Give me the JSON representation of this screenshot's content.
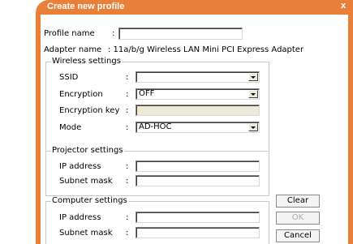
{
  "window": {
    "title": "Create new profile",
    "close_glyph": "x"
  },
  "profile": {
    "label": "Profile name",
    "colon": ":",
    "value": ""
  },
  "adapter": {
    "label": "Adapter name",
    "value": ": 11a/b/g Wireless LAN Mini PCI Express Adapter"
  },
  "wireless": {
    "title": "Wireless settings",
    "ssid": {
      "label": "SSID",
      "colon": ":",
      "value": ""
    },
    "encryption": {
      "label": "Encryption",
      "colon": ":",
      "value": "OFF"
    },
    "key": {
      "label": "Encryption key",
      "colon": ":",
      "value": ""
    },
    "mode": {
      "label": "Mode",
      "colon": ":",
      "value": "AD-HOC"
    }
  },
  "projector": {
    "title": "Projector settings",
    "ip": {
      "label": "IP address",
      "colon": ":",
      "value": ""
    },
    "mask": {
      "label": "Subnet mask",
      "colon": ":",
      "value": ""
    }
  },
  "computer": {
    "title": "Computer settings",
    "ip": {
      "label": "IP address",
      "colon": ":",
      "value": ""
    },
    "mask": {
      "label": "Subnet mask",
      "colon": ":",
      "value": ""
    }
  },
  "buttons": {
    "clear": "Clear",
    "ok": "OK",
    "cancel": "Cancel"
  }
}
